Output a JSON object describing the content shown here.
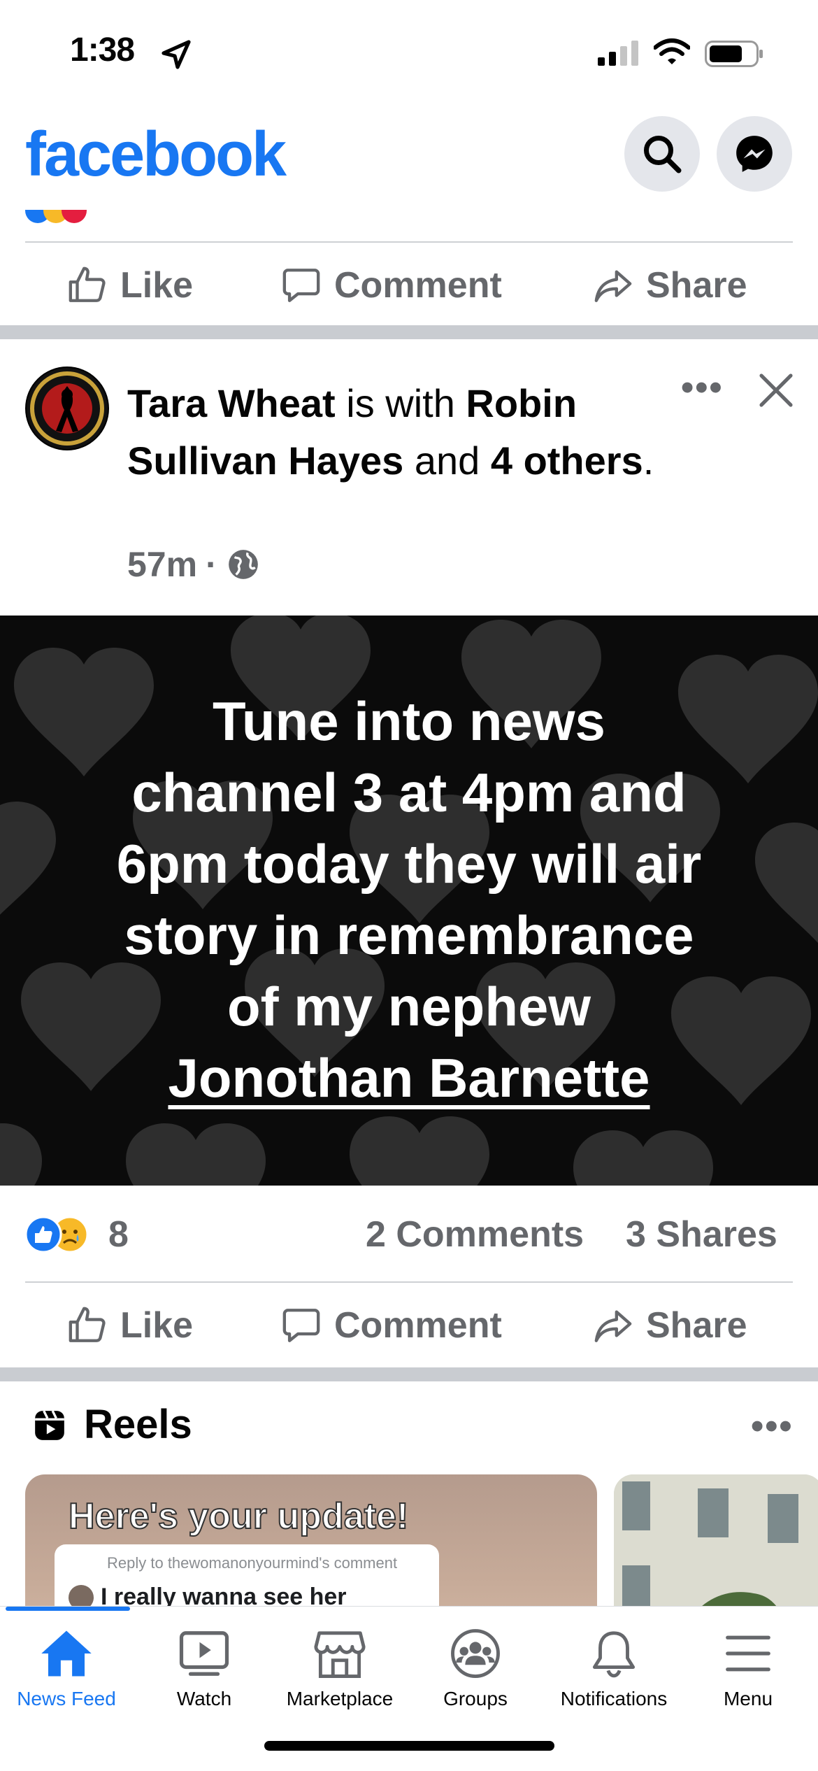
{
  "status_bar": {
    "time": "1:38"
  },
  "header": {
    "logo": "facebook"
  },
  "prev_post": {
    "actions": {
      "like": "Like",
      "comment": "Comment",
      "share": "Share"
    }
  },
  "post": {
    "author": "Tara Wheat",
    "with_text": " is with ",
    "tagged": "Robin Sullivan Hayes",
    "and_text": " and ",
    "others": "4 others",
    "end": ".",
    "time": "57m",
    "meta_sep": "·",
    "image_text_lines": [
      "Tune into news",
      "channel 3 at 4pm and",
      "6pm today they will air",
      "story in remembrance",
      "of my nephew"
    ],
    "image_name": "Jonothan Barnette",
    "reaction_count": "8",
    "comments": "2 Comments",
    "shares": "3 Shares",
    "actions": {
      "like": "Like",
      "comment": "Comment",
      "share": "Share"
    }
  },
  "reels": {
    "title": "Reels",
    "card1": {
      "headline": "Here's your update!",
      "reply_to": "Reply to thewomanonyourmind's comment",
      "comment": "I really wanna see her"
    }
  },
  "tabs": [
    {
      "label": "News Feed",
      "icon": "home-icon",
      "active": true
    },
    {
      "label": "Watch",
      "icon": "watch-icon",
      "active": false
    },
    {
      "label": "Marketplace",
      "icon": "marketplace-icon",
      "active": false
    },
    {
      "label": "Groups",
      "icon": "groups-icon",
      "active": false
    },
    {
      "label": "Notifications",
      "icon": "bell-icon",
      "active": false
    },
    {
      "label": "Menu",
      "icon": "menu-icon",
      "active": false
    }
  ],
  "colors": {
    "brand": "#1877f2",
    "secondary_text": "#65676b",
    "separator": "#c9ccd1"
  }
}
